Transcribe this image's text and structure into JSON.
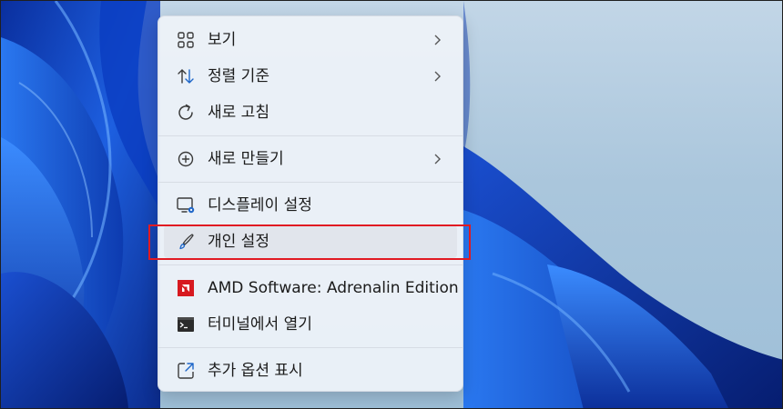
{
  "context_menu": {
    "items": [
      {
        "id": "view",
        "label": "보기",
        "icon": "grid-icon",
        "has_submenu": true
      },
      {
        "id": "sort",
        "label": "정렬 기준",
        "icon": "sort-arrows-icon",
        "has_submenu": true
      },
      {
        "id": "refresh",
        "label": "새로 고침",
        "icon": "refresh-icon",
        "has_submenu": false
      },
      {
        "id": "new",
        "label": "새로 만들기",
        "icon": "plus-circle-icon",
        "has_submenu": true
      },
      {
        "id": "display",
        "label": "디스플레이 설정",
        "icon": "display-settings-icon",
        "has_submenu": false
      },
      {
        "id": "personalize",
        "label": "개인 설정",
        "icon": "brush-icon",
        "has_submenu": false,
        "highlighted": true
      },
      {
        "id": "amd",
        "label": "AMD Software: Adrenalin Edition",
        "icon": "amd-logo-icon",
        "has_submenu": false
      },
      {
        "id": "terminal",
        "label": "터미널에서 열기",
        "icon": "terminal-icon",
        "has_submenu": false
      },
      {
        "id": "more",
        "label": "추가 옵션 표시",
        "icon": "share-external-icon",
        "has_submenu": false
      }
    ]
  },
  "colors": {
    "highlight_border": "#e11a22",
    "amd_red": "#d71920",
    "accent_blue": "#1e66c8"
  }
}
